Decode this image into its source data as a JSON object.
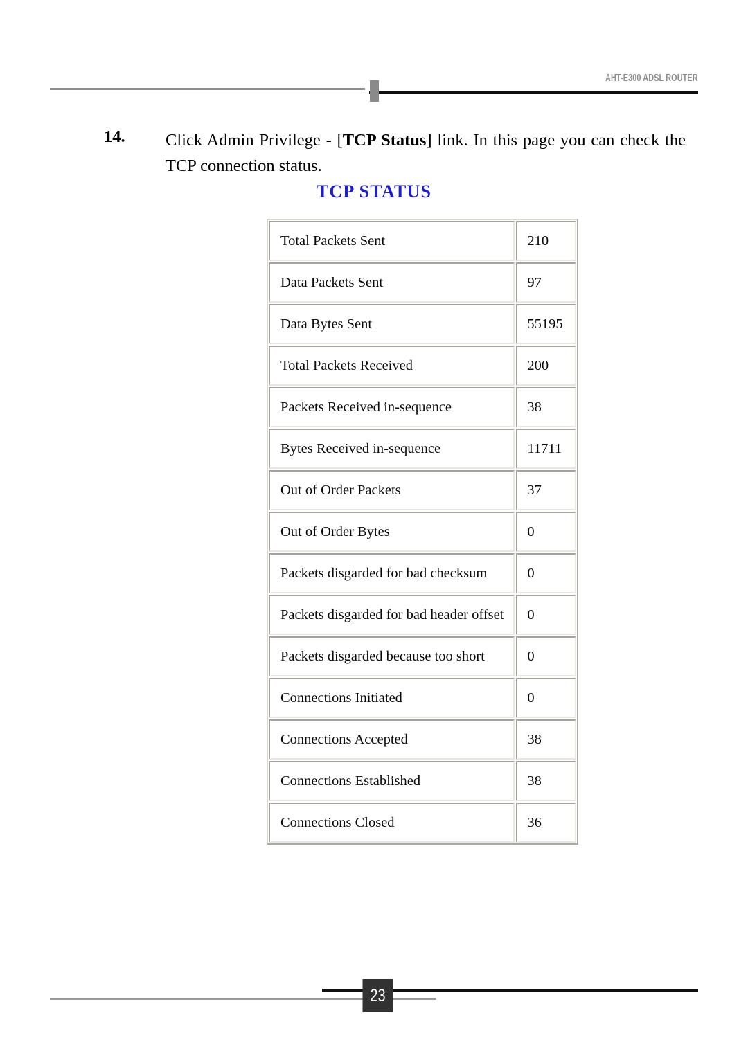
{
  "header": {
    "title": "AHT-E300 ADSL ROUTER"
  },
  "instruction": {
    "number": "14.",
    "text_part1": "Click Admin Privilege - [",
    "text_bold": "TCP Status",
    "text_part2": "] link. In this page you can check the TCP connection status."
  },
  "panel": {
    "title": "TCP STATUS",
    "title_color": "#1d1dcc",
    "rows": [
      {
        "label": "Total Packets Sent",
        "value": "210"
      },
      {
        "label": "Data Packets Sent",
        "value": "97"
      },
      {
        "label": "Data Bytes Sent",
        "value": "55195"
      },
      {
        "label": "Total Packets Received",
        "value": "200"
      },
      {
        "label": "Packets Received in-sequence",
        "value": "38"
      },
      {
        "label": "Bytes Received in-sequence",
        "value": "11711"
      },
      {
        "label": "Out of Order Packets",
        "value": "37"
      },
      {
        "label": "Out of Order Bytes",
        "value": "0"
      },
      {
        "label": "Packets disgarded for bad checksum",
        "value": "0"
      },
      {
        "label": "Packets disgarded for bad header offset",
        "value": "0"
      },
      {
        "label": "Packets disgarded because too short",
        "value": "0"
      },
      {
        "label": "Connections Initiated",
        "value": "0"
      },
      {
        "label": "Connections Accepted",
        "value": "38"
      },
      {
        "label": "Connections Established",
        "value": "38"
      },
      {
        "label": "Connections Closed",
        "value": "36"
      }
    ]
  },
  "footer": {
    "page_number": "23"
  }
}
